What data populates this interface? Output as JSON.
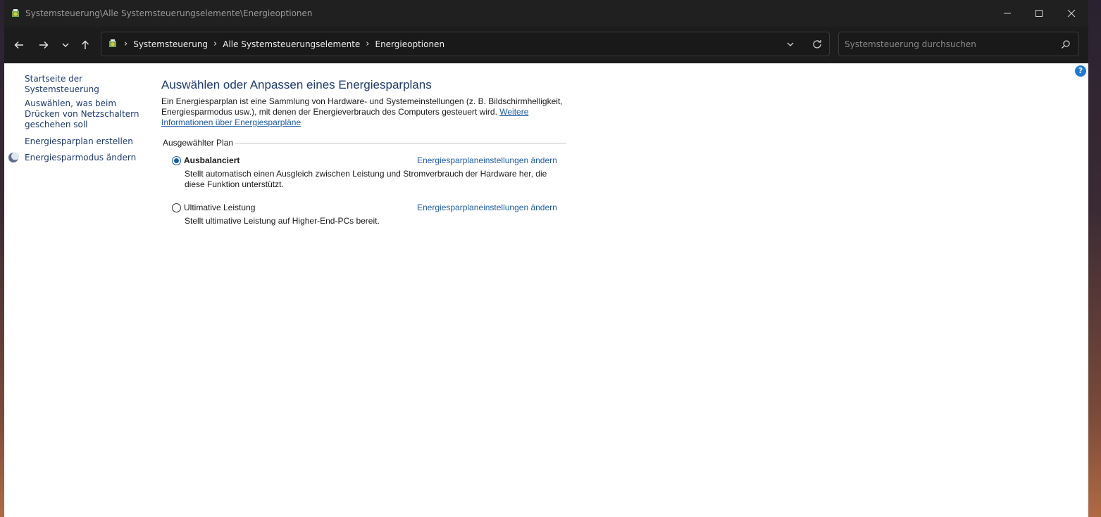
{
  "window": {
    "title": "Systemsteuerung\\Alle Systemsteuerungselemente\\Energieoptionen"
  },
  "breadcrumb": [
    "Systemsteuerung",
    "Alle Systemsteuerungselemente",
    "Energieoptionen"
  ],
  "search": {
    "placeholder": "Systemsteuerung durchsuchen"
  },
  "sidebar": {
    "items": [
      {
        "label": "Startseite der Systemsteuerung"
      },
      {
        "label": "Auswählen, was beim Drücken von Netzschaltern geschehen soll"
      },
      {
        "label": "Energiesparplan erstellen"
      },
      {
        "label": "Energiesparmodus ändern"
      }
    ]
  },
  "main": {
    "title": "Auswählen oder Anpassen eines Energiesparplans",
    "description": "Ein Energiesparplan ist eine Sammlung von Hardware- und Systemeinstellungen (z. B. Bildschirmhelligkeit, Energiesparmodus usw.), mit denen der Energieverbrauch des Computers gesteuert wird.",
    "more_link": "Weitere Informationen über Energiesparpläne",
    "section_label": "Ausgewählter Plan",
    "plans": [
      {
        "name": "Ausbalanciert",
        "selected": true,
        "link": "Energiesparplaneinstellungen ändern",
        "description": "Stellt automatisch einen Ausgleich zwischen Leistung und Stromverbrauch der Hardware her, die diese Funktion unterstützt."
      },
      {
        "name": "Ultimative Leistung",
        "selected": false,
        "link": "Energiesparplaneinstellungen ändern",
        "description": "Stellt ultimative Leistung auf Higher-End-PCs bereit."
      }
    ]
  },
  "help": {
    "label": "?"
  },
  "colors": {
    "link": "#1e5aa8",
    "heading": "#1e3a6e",
    "titlebar": "#202020"
  }
}
